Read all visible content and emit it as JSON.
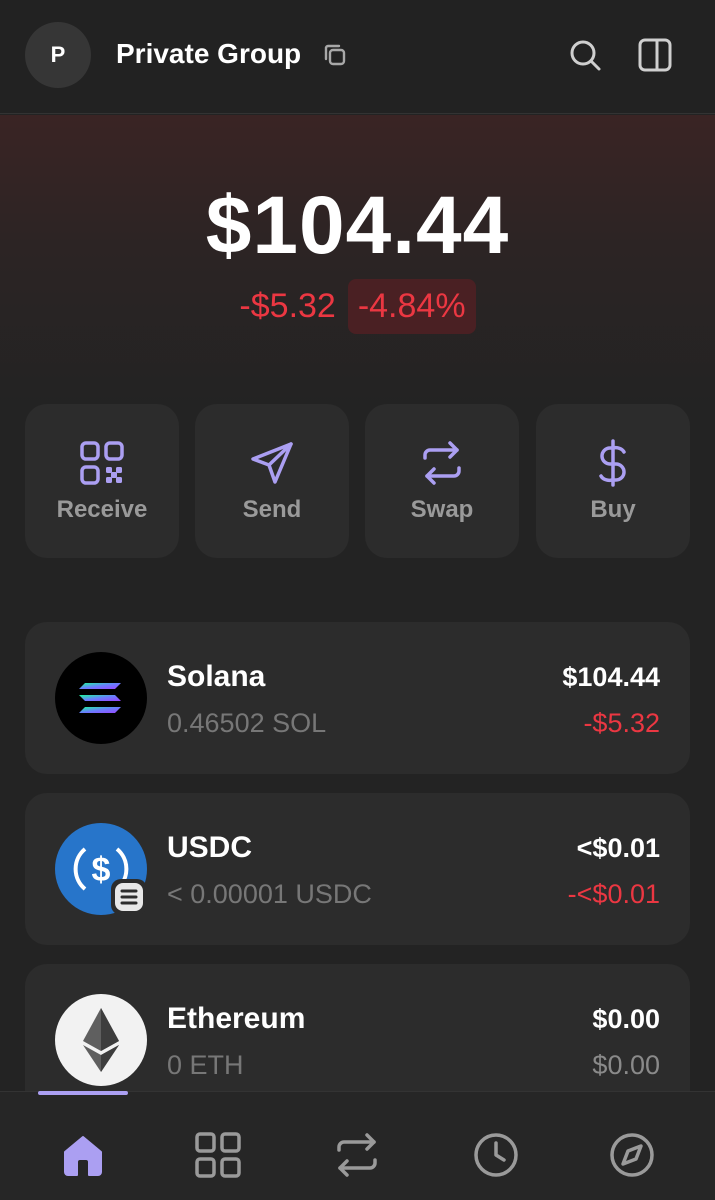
{
  "header": {
    "avatar_letter": "P",
    "account_name": "Private Group"
  },
  "balance": {
    "total": "$104.44",
    "change_abs": "-$5.32",
    "change_pct": "-4.84%"
  },
  "actions": [
    {
      "label": "Receive",
      "icon": "qr-code-icon"
    },
    {
      "label": "Send",
      "icon": "send-icon"
    },
    {
      "label": "Swap",
      "icon": "swap-icon"
    },
    {
      "label": "Buy",
      "icon": "dollar-icon"
    }
  ],
  "tokens": [
    {
      "name": "Solana",
      "amount": "0.46502 SOL",
      "value": "$104.44",
      "delta": "-$5.32",
      "icon": "solana-logo"
    },
    {
      "name": "USDC",
      "amount": "< 0.00001 USDC",
      "value": "<$0.01",
      "delta": "-<$0.01",
      "icon": "usdc-logo"
    },
    {
      "name": "Ethereum",
      "amount": "0 ETH",
      "value": "$0.00",
      "delta": "$0.00",
      "icon": "ethereum-logo"
    }
  ],
  "nav": [
    {
      "icon": "home-icon",
      "active": true
    },
    {
      "icon": "collectibles-grid-icon",
      "active": false
    },
    {
      "icon": "swap-icon",
      "active": false
    },
    {
      "icon": "activity-clock-icon",
      "active": false
    },
    {
      "icon": "explore-compass-icon",
      "active": false
    }
  ],
  "colors": {
    "accent": "#ab9ff2",
    "negative": "#eb3742",
    "background": "#232323",
    "card": "#2c2c2c"
  }
}
